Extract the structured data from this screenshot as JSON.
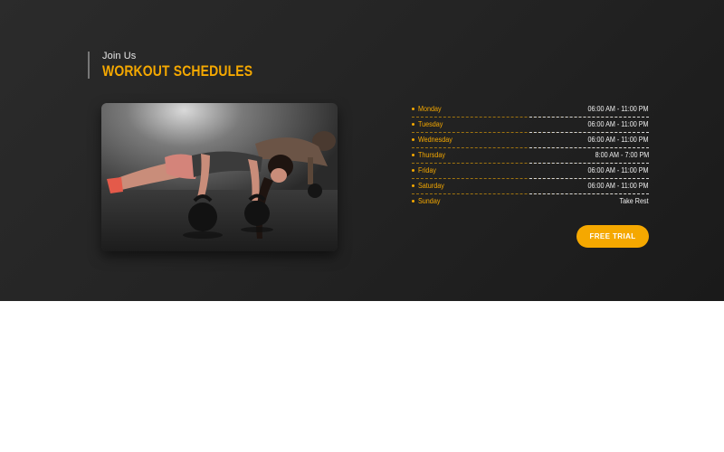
{
  "section": {
    "subtitle": "Join Us",
    "title": "WORKOUT SCHEDULES"
  },
  "image": {
    "content": "photo-woman-kettlebell-pushups"
  },
  "schedule": [
    {
      "day": "Monday",
      "time": "06:00 AM - 11:00 PM"
    },
    {
      "day": "Tuesday",
      "time": "06:00 AM - 11:00 PM"
    },
    {
      "day": "Wednesday",
      "time": "06:00 AM - 11:00 PM"
    },
    {
      "day": "Thursday",
      "time": "8:00 AM - 7:00 PM"
    },
    {
      "day": "Friday",
      "time": "06:00 AM - 11:00 PM"
    },
    {
      "day": "Saturday",
      "time": "06:00 AM - 11:00 PM"
    },
    {
      "day": "Sunday",
      "time": "Take Rest"
    }
  ],
  "cta": {
    "label": "FREE TRIAL"
  },
  "colors": {
    "accent": "#f5a800",
    "background": "#242424",
    "text": "#f0f0f0"
  }
}
